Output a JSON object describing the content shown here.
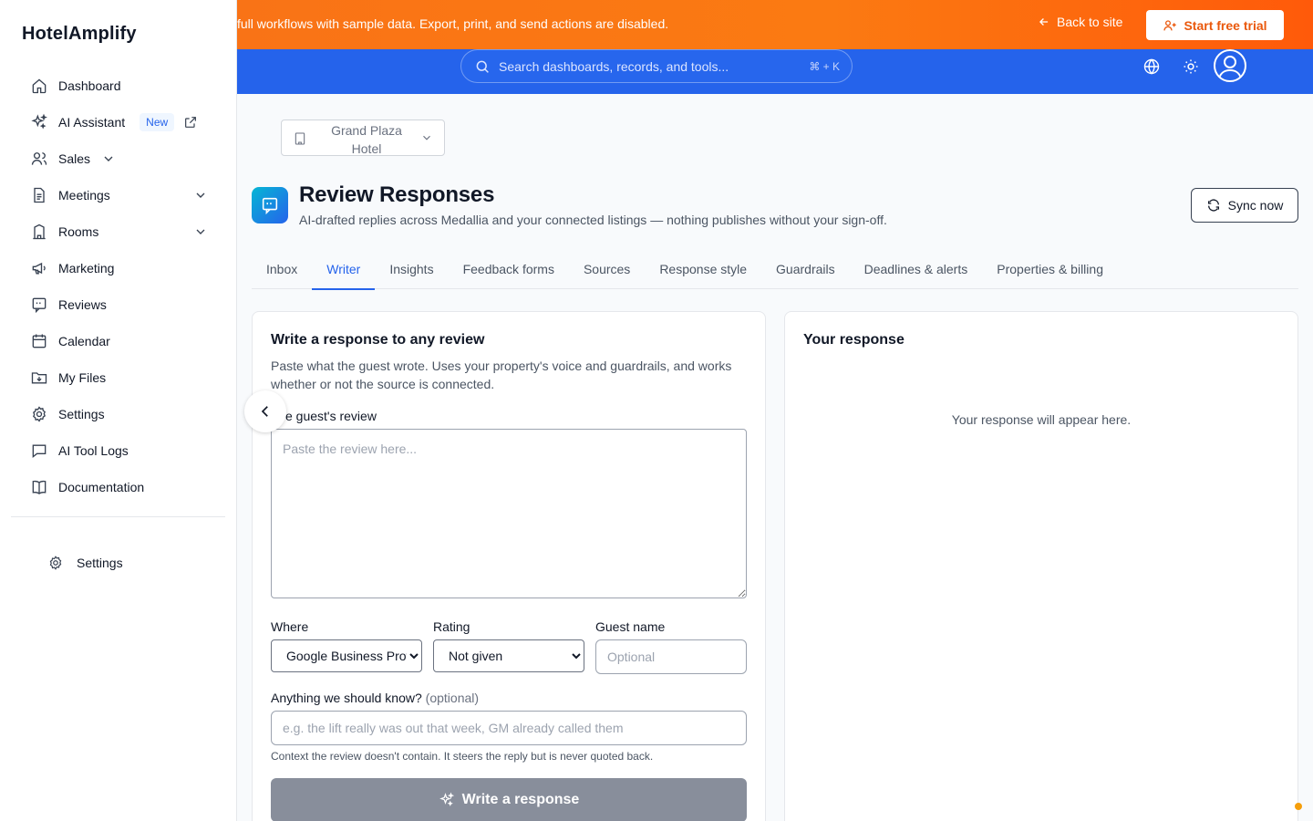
{
  "app": {
    "brand": "HotelAmplify"
  },
  "sidebar": {
    "items": [
      {
        "label": "Dashboard",
        "icon": "home-icon"
      },
      {
        "label": "AI Assistant",
        "icon": "sparkles-icon",
        "badge": "New"
      },
      {
        "label": "Sales",
        "icon": "users-icon"
      },
      {
        "label": "Meetings",
        "icon": "document-icon"
      },
      {
        "label": "Rooms",
        "icon": "building-icon"
      },
      {
        "label": "Marketing",
        "icon": "megaphone-icon"
      },
      {
        "label": "Reviews",
        "icon": "review-icon"
      },
      {
        "label": "Calendar",
        "icon": "calendar-icon"
      },
      {
        "label": "My Files",
        "icon": "folder-icon"
      },
      {
        "label": "Settings",
        "icon": "gear-icon"
      },
      {
        "label": "AI Tool Logs",
        "icon": "chat-icon"
      },
      {
        "label": "Documentation",
        "icon": "book-icon"
      }
    ],
    "bottom_settings": "Settings"
  },
  "promo": {
    "text": "full workflows with sample data. Export, print, and send actions are disabled.",
    "back_label": "Back to site",
    "trial_label": "Start free trial"
  },
  "topbar": {
    "search_placeholder": "Search dashboards, records, and tools...",
    "search_shortcut": "⌘ + K"
  },
  "property": {
    "selected": "Grand Plaza Hotel"
  },
  "page": {
    "title": "Review Responses",
    "subtitle": "AI-drafted replies across Medallia and your connected listings — nothing publishes without your sign-off.",
    "sync_label": "Sync now"
  },
  "tabs": [
    {
      "label": "Inbox"
    },
    {
      "label": "Writer",
      "active": true
    },
    {
      "label": "Insights"
    },
    {
      "label": "Feedback forms"
    },
    {
      "label": "Sources"
    },
    {
      "label": "Response style"
    },
    {
      "label": "Guardrails"
    },
    {
      "label": "Deadlines & alerts"
    },
    {
      "label": "Properties & billing"
    }
  ],
  "writer": {
    "title": "Write a response to any review",
    "description": "Paste what the guest wrote. Uses your property's voice and guardrails, and works whether or not the source is connected.",
    "review_label": "e guest's review",
    "review_placeholder": "Paste the review here...",
    "where_label": "Where",
    "where_value": "Google Business Profile",
    "rating_label": "Rating",
    "rating_value": "Not given",
    "guest_label": "Guest name",
    "guest_placeholder": "Optional",
    "context_label": "Anything we should know?",
    "context_optional": "(optional)",
    "context_placeholder": "e.g. the lift really was out that week, GM already called them",
    "context_help": "Context the review doesn't contain. It steers the reply but is never quoted back.",
    "button_label": "Write a response"
  },
  "response": {
    "title": "Your response",
    "empty": "Your response will appear here."
  },
  "colors": {
    "accent": "#2563eb",
    "promo": "#f97316",
    "disabled_button": "#888e9b"
  }
}
